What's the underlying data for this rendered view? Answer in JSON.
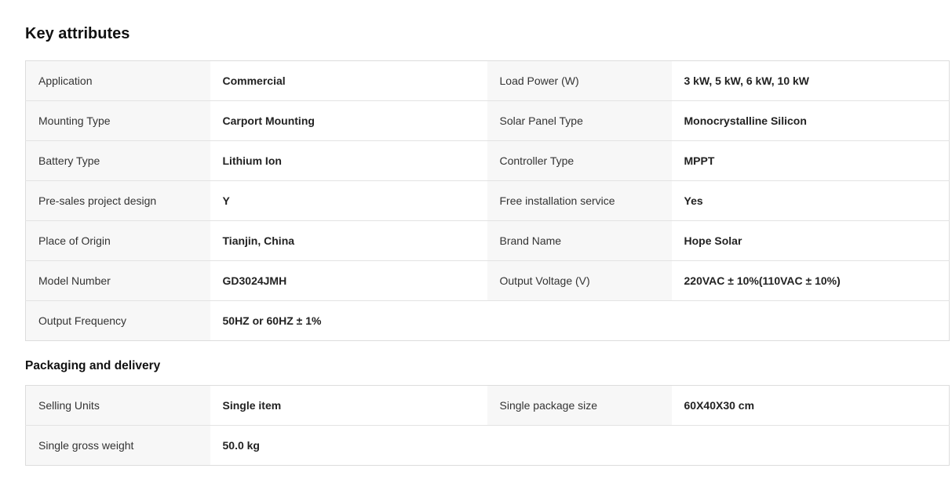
{
  "key_attributes": {
    "title": "Key attributes",
    "rows": [
      [
        {
          "label": "Application",
          "value": "Commercial"
        },
        {
          "label": "Load Power (W)",
          "value": "3 kW, 5 kW, 6 kW, 10 kW"
        }
      ],
      [
        {
          "label": "Mounting Type",
          "value": "Carport Mounting"
        },
        {
          "label": "Solar Panel Type",
          "value": "Monocrystalline Silicon"
        }
      ],
      [
        {
          "label": "Battery Type",
          "value": "Lithium Ion"
        },
        {
          "label": "Controller Type",
          "value": "MPPT"
        }
      ],
      [
        {
          "label": "Pre-sales project design",
          "value": "Y"
        },
        {
          "label": "Free installation service",
          "value": "Yes"
        }
      ],
      [
        {
          "label": "Place of Origin",
          "value": "Tianjin, China"
        },
        {
          "label": "Brand Name",
          "value": "Hope Solar"
        }
      ],
      [
        {
          "label": "Model Number",
          "value": "GD3024JMH"
        },
        {
          "label": "Output Voltage (V)",
          "value": "220VAC ± 10%(110VAC ± 10%)"
        }
      ],
      [
        {
          "label": "Output Frequency",
          "value": "50HZ or 60HZ ± 1%"
        }
      ]
    ]
  },
  "packaging": {
    "title": "Packaging and delivery",
    "rows": [
      [
        {
          "label": "Selling Units",
          "value": "Single item"
        },
        {
          "label": "Single package size",
          "value": "60X40X30 cm"
        }
      ],
      [
        {
          "label": "Single gross weight",
          "value": "50.0 kg"
        }
      ]
    ]
  }
}
